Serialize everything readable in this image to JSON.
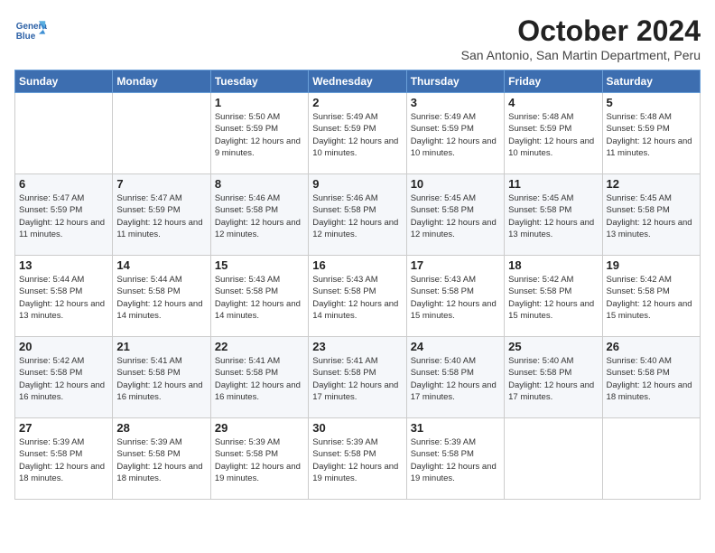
{
  "header": {
    "logo_line1": "General",
    "logo_line2": "Blue",
    "month": "October 2024",
    "location": "San Antonio, San Martin Department, Peru"
  },
  "weekdays": [
    "Sunday",
    "Monday",
    "Tuesday",
    "Wednesday",
    "Thursday",
    "Friday",
    "Saturday"
  ],
  "weeks": [
    [
      {
        "day": "",
        "info": ""
      },
      {
        "day": "",
        "info": ""
      },
      {
        "day": "1",
        "info": "Sunrise: 5:50 AM\nSunset: 5:59 PM\nDaylight: 12 hours and 9 minutes."
      },
      {
        "day": "2",
        "info": "Sunrise: 5:49 AM\nSunset: 5:59 PM\nDaylight: 12 hours and 10 minutes."
      },
      {
        "day": "3",
        "info": "Sunrise: 5:49 AM\nSunset: 5:59 PM\nDaylight: 12 hours and 10 minutes."
      },
      {
        "day": "4",
        "info": "Sunrise: 5:48 AM\nSunset: 5:59 PM\nDaylight: 12 hours and 10 minutes."
      },
      {
        "day": "5",
        "info": "Sunrise: 5:48 AM\nSunset: 5:59 PM\nDaylight: 12 hours and 11 minutes."
      }
    ],
    [
      {
        "day": "6",
        "info": "Sunrise: 5:47 AM\nSunset: 5:59 PM\nDaylight: 12 hours and 11 minutes."
      },
      {
        "day": "7",
        "info": "Sunrise: 5:47 AM\nSunset: 5:59 PM\nDaylight: 12 hours and 11 minutes."
      },
      {
        "day": "8",
        "info": "Sunrise: 5:46 AM\nSunset: 5:58 PM\nDaylight: 12 hours and 12 minutes."
      },
      {
        "day": "9",
        "info": "Sunrise: 5:46 AM\nSunset: 5:58 PM\nDaylight: 12 hours and 12 minutes."
      },
      {
        "day": "10",
        "info": "Sunrise: 5:45 AM\nSunset: 5:58 PM\nDaylight: 12 hours and 12 minutes."
      },
      {
        "day": "11",
        "info": "Sunrise: 5:45 AM\nSunset: 5:58 PM\nDaylight: 12 hours and 13 minutes."
      },
      {
        "day": "12",
        "info": "Sunrise: 5:45 AM\nSunset: 5:58 PM\nDaylight: 12 hours and 13 minutes."
      }
    ],
    [
      {
        "day": "13",
        "info": "Sunrise: 5:44 AM\nSunset: 5:58 PM\nDaylight: 12 hours and 13 minutes."
      },
      {
        "day": "14",
        "info": "Sunrise: 5:44 AM\nSunset: 5:58 PM\nDaylight: 12 hours and 14 minutes."
      },
      {
        "day": "15",
        "info": "Sunrise: 5:43 AM\nSunset: 5:58 PM\nDaylight: 12 hours and 14 minutes."
      },
      {
        "day": "16",
        "info": "Sunrise: 5:43 AM\nSunset: 5:58 PM\nDaylight: 12 hours and 14 minutes."
      },
      {
        "day": "17",
        "info": "Sunrise: 5:43 AM\nSunset: 5:58 PM\nDaylight: 12 hours and 15 minutes."
      },
      {
        "day": "18",
        "info": "Sunrise: 5:42 AM\nSunset: 5:58 PM\nDaylight: 12 hours and 15 minutes."
      },
      {
        "day": "19",
        "info": "Sunrise: 5:42 AM\nSunset: 5:58 PM\nDaylight: 12 hours and 15 minutes."
      }
    ],
    [
      {
        "day": "20",
        "info": "Sunrise: 5:42 AM\nSunset: 5:58 PM\nDaylight: 12 hours and 16 minutes."
      },
      {
        "day": "21",
        "info": "Sunrise: 5:41 AM\nSunset: 5:58 PM\nDaylight: 12 hours and 16 minutes."
      },
      {
        "day": "22",
        "info": "Sunrise: 5:41 AM\nSunset: 5:58 PM\nDaylight: 12 hours and 16 minutes."
      },
      {
        "day": "23",
        "info": "Sunrise: 5:41 AM\nSunset: 5:58 PM\nDaylight: 12 hours and 17 minutes."
      },
      {
        "day": "24",
        "info": "Sunrise: 5:40 AM\nSunset: 5:58 PM\nDaylight: 12 hours and 17 minutes."
      },
      {
        "day": "25",
        "info": "Sunrise: 5:40 AM\nSunset: 5:58 PM\nDaylight: 12 hours and 17 minutes."
      },
      {
        "day": "26",
        "info": "Sunrise: 5:40 AM\nSunset: 5:58 PM\nDaylight: 12 hours and 18 minutes."
      }
    ],
    [
      {
        "day": "27",
        "info": "Sunrise: 5:39 AM\nSunset: 5:58 PM\nDaylight: 12 hours and 18 minutes."
      },
      {
        "day": "28",
        "info": "Sunrise: 5:39 AM\nSunset: 5:58 PM\nDaylight: 12 hours and 18 minutes."
      },
      {
        "day": "29",
        "info": "Sunrise: 5:39 AM\nSunset: 5:58 PM\nDaylight: 12 hours and 19 minutes."
      },
      {
        "day": "30",
        "info": "Sunrise: 5:39 AM\nSunset: 5:58 PM\nDaylight: 12 hours and 19 minutes."
      },
      {
        "day": "31",
        "info": "Sunrise: 5:39 AM\nSunset: 5:58 PM\nDaylight: 12 hours and 19 minutes."
      },
      {
        "day": "",
        "info": ""
      },
      {
        "day": "",
        "info": ""
      }
    ]
  ]
}
